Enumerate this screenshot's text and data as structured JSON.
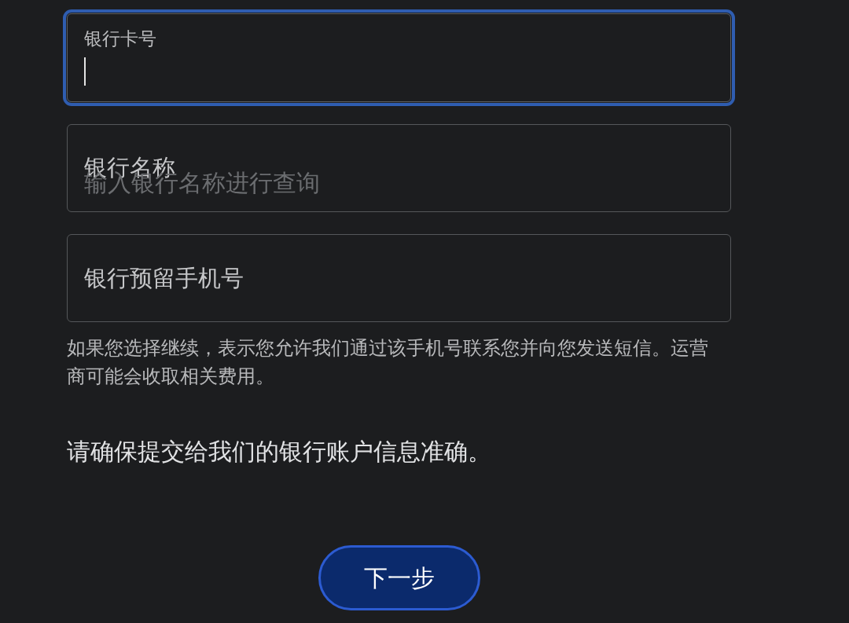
{
  "fields": [
    {
      "label": "银行卡号",
      "focused": true
    },
    {
      "label": "银行名称",
      "placeholder": "输入银行名称进行查询",
      "focused": false
    },
    {
      "label": "银行预留手机号",
      "focused": false
    }
  ],
  "notice": "如果您选择继续，表示您允许我们通过该手机号联系您并向您发送短信。运营商可能会收取相关费用。",
  "statement": "请确保提交给我们的银行账户信息准确。",
  "next_button": {
    "label": "下一步"
  }
}
